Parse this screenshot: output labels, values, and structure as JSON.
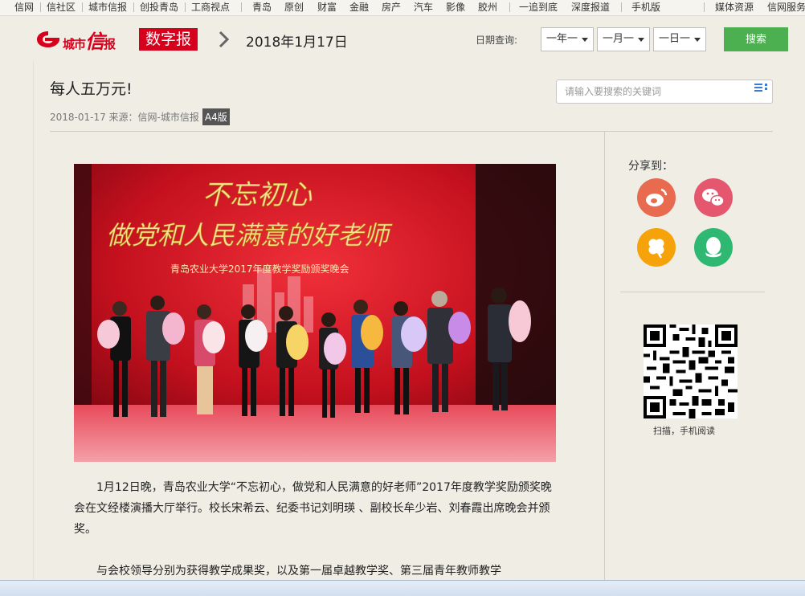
{
  "topnav": {
    "items": [
      "信网",
      "信社区",
      "城市信报",
      "创投青岛",
      "工商视点",
      "青岛",
      "原创",
      "财富",
      "金融",
      "房产",
      "汽车",
      "影像",
      "胶州",
      "一追到底",
      "深度报道",
      "手机版",
      "媒体资源",
      "信网服务"
    ]
  },
  "header": {
    "logo_text": "城市",
    "logo_big": "信",
    "logo_tail": "报",
    "digital_label": "数字报",
    "date": "2018年1月17日",
    "query_label": "日期查询:",
    "year_sel": "一年一",
    "month_sel": "一月一",
    "day_sel": "一日一",
    "search_button": "搜索"
  },
  "article": {
    "title": "每人五万元!",
    "meta": "2018-01-17 来源：信网-城市信报",
    "page_badge": "A4版",
    "keyword_placeholder": "请输入要搜索的关键词",
    "paragraphs": [
      "1月12日晚，青岛农业大学“不忘初心，做党和人民满意的好老师”2017年度教学奖励颁奖晚会在文经楼演播大厅举行。校长宋希云、纪委书记刘明瑛 、副校长牟少岩、刘春霞出席晚会并颁奖。",
      "与会校领导分别为获得教学成果奖，以及第一届卓越教学奖、第三届青年教师教学"
    ]
  },
  "photo": {
    "banner_line1": "不忘初心",
    "banner_line2": "做党和人民满意的好老师",
    "banner_line3": "青岛农业大学2017年度教学奖励颁奖晚会"
  },
  "sidebar": {
    "share_label": "分享到：",
    "qr_label": "扫描，手机阅读"
  },
  "colors": {
    "brand_red": "#d6001c",
    "search_green": "#4caf50",
    "weibo": "#e86a4f",
    "wechat": "#e4576f",
    "qzone": "#f5a20b",
    "qq": "#2eb872"
  }
}
